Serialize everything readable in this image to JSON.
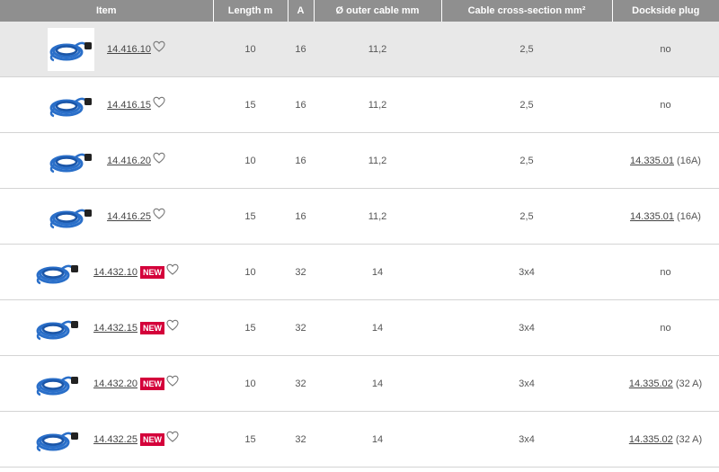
{
  "headers": {
    "item": "Item",
    "length": "Length m",
    "amp": "A",
    "diameter": "Ø outer cable mm",
    "section": "Cable cross-section mm²",
    "plug": "Dockside plug"
  },
  "rows": [
    {
      "item": "14.416.10",
      "badge": "",
      "length": "10",
      "amp": "16",
      "diameter": "11,2",
      "section": "2,5",
      "plug_text": "no",
      "plug_link": "",
      "plug_note": ""
    },
    {
      "item": "14.416.15",
      "badge": "",
      "length": "15",
      "amp": "16",
      "diameter": "11,2",
      "section": "2,5",
      "plug_text": "no",
      "plug_link": "",
      "plug_note": ""
    },
    {
      "item": "14.416.20",
      "badge": "",
      "length": "10",
      "amp": "16",
      "diameter": "11,2",
      "section": "2,5",
      "plug_text": "",
      "plug_link": "14.335.01",
      "plug_note": " (16A)"
    },
    {
      "item": "14.416.25",
      "badge": "",
      "length": "15",
      "amp": "16",
      "diameter": "11,2",
      "section": "2,5",
      "plug_text": "",
      "plug_link": "14.335.01",
      "plug_note": " (16A)"
    },
    {
      "item": "14.432.10",
      "badge": "NEW",
      "length": "10",
      "amp": "32",
      "diameter": "14",
      "section": "3x4",
      "plug_text": "no",
      "plug_link": "",
      "plug_note": ""
    },
    {
      "item": "14.432.15",
      "badge": "NEW",
      "length": "15",
      "amp": "32",
      "diameter": "14",
      "section": "3x4",
      "plug_text": "no",
      "plug_link": "",
      "plug_note": ""
    },
    {
      "item": "14.432.20",
      "badge": "NEW",
      "length": "10",
      "amp": "32",
      "diameter": "14",
      "section": "3x4",
      "plug_text": "",
      "plug_link": "14.335.02",
      "plug_note": " (32 A)"
    },
    {
      "item": "14.432.25",
      "badge": "NEW",
      "length": "15",
      "amp": "32",
      "diameter": "14",
      "section": "3x4",
      "plug_text": "",
      "plug_link": "14.335.02",
      "plug_note": " (32 A)"
    }
  ],
  "colors": {
    "header_bg": "#8f8f8f",
    "highlight_row": "#e8e8e8",
    "badge": "#d4003a",
    "cable_blue": "#2a6fc9"
  }
}
